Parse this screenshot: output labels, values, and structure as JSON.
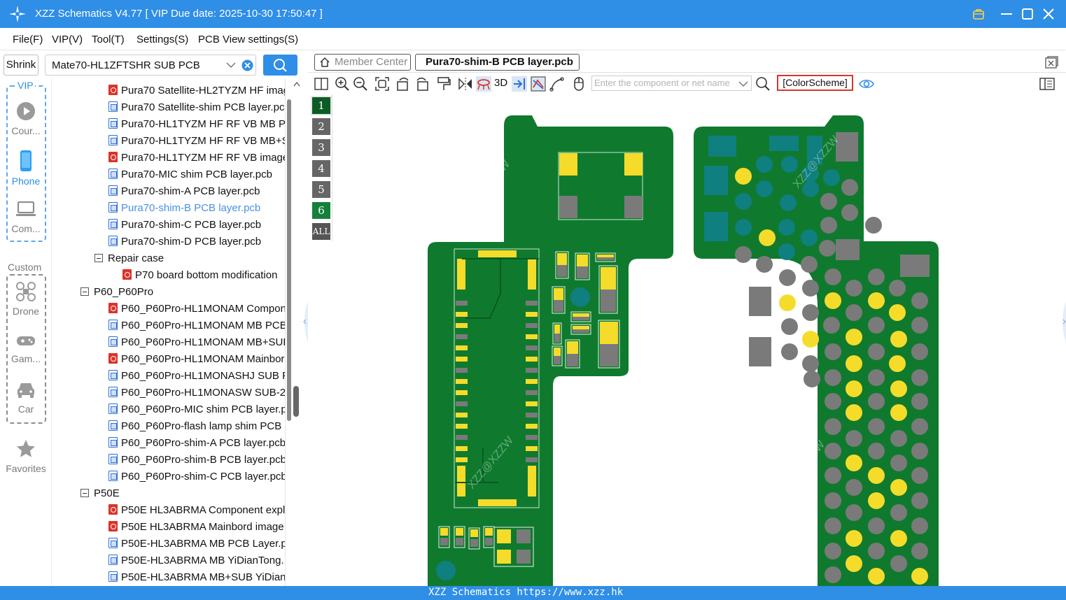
{
  "app": {
    "title": "XZZ Schematics V4.77 [ VIP Due date: 2025-10-30 17:50:47 ]"
  },
  "menu": [
    "File(F)",
    "VIP(V)",
    "Tool(T)",
    "Settings(S)",
    "PCB View settings(S)"
  ],
  "left": {
    "shrink_label": "Shrink",
    "db_value": "Mate70-HL1ZFTSHR SUB PCB",
    "vip_label": "VIP",
    "custom_label": "Custom",
    "vip_items": [
      {
        "label": "Cour...",
        "icon": "play-circle-icon"
      },
      {
        "label": "Phone",
        "icon": "phone-icon",
        "active": true
      },
      {
        "label": "Com...",
        "icon": "laptop-icon"
      }
    ],
    "custom_items": [
      {
        "label": "Drone",
        "icon": "drone-icon"
      },
      {
        "label": "Gam...",
        "icon": "gamepad-icon"
      },
      {
        "label": "Car",
        "icon": "car-icon"
      }
    ],
    "favorites_label": "Favorites"
  },
  "tree": [
    {
      "type": "pdf",
      "label": "Pura70 Satellite-HL2TYZM HF imag",
      "level": 2
    },
    {
      "type": "pcb",
      "label": "Pura70 Satellite-shim PCB layer.pcl",
      "level": 2
    },
    {
      "type": "pcb",
      "label": "Pura70-HL1TYZM HF RF VB MB PC",
      "level": 2
    },
    {
      "type": "pcb",
      "label": "Pura70-HL1TYZM HF RF VB MB+SU",
      "level": 2
    },
    {
      "type": "pdf",
      "label": "Pura70-HL1TYZM HF RF VB image.",
      "level": 2
    },
    {
      "type": "pcb",
      "label": "Pura70-MIC shim PCB layer.pcb",
      "level": 2
    },
    {
      "type": "pcb",
      "label": "Pura70-shim-A PCB layer.pcb",
      "level": 2
    },
    {
      "type": "pcb",
      "label": "Pura70-shim-B PCB layer.pcb",
      "level": 2,
      "selected": true
    },
    {
      "type": "pcb",
      "label": "Pura70-shim-C PCB layer.pcb",
      "level": 2
    },
    {
      "type": "pcb",
      "label": "Pura70-shim-D PCB layer.pcb",
      "level": 2
    },
    {
      "type": "folder",
      "label": "Repair case",
      "level": 2
    },
    {
      "type": "pdf",
      "label": "P70 board bottom modification",
      "level": 3
    },
    {
      "type": "folder",
      "label": "P60_P60Pro",
      "level": 1
    },
    {
      "type": "pdf",
      "label": "P60_P60Pro-HL1MONAM Compon",
      "level": 2
    },
    {
      "type": "pcb",
      "label": "P60_P60Pro-HL1MONAM MB PCB",
      "level": 2
    },
    {
      "type": "pcb",
      "label": "P60_P60Pro-HL1MONAM MB+SUE",
      "level": 2
    },
    {
      "type": "pdf",
      "label": "P60_P60Pro-HL1MONAM Mainbor",
      "level": 2
    },
    {
      "type": "pcb",
      "label": "P60_P60Pro-HL1MONASHJ SUB PC",
      "level": 2
    },
    {
      "type": "pcb",
      "label": "P60_P60Pro-HL1MONASW SUB-2 I",
      "level": 2
    },
    {
      "type": "pcb",
      "label": "P60_P60Pro-MIC shim PCB layer.pc",
      "level": 2
    },
    {
      "type": "pcb",
      "label": "P60_P60Pro-flash lamp shim PCB l",
      "level": 2
    },
    {
      "type": "pcb",
      "label": "P60_P60Pro-shim-A PCB layer.pcb",
      "level": 2
    },
    {
      "type": "pcb",
      "label": "P60_P60Pro-shim-B PCB layer.pcb",
      "level": 2
    },
    {
      "type": "pcb",
      "label": "P60_P60Pro-shim-C PCB layer.pcb",
      "level": 2
    },
    {
      "type": "folder",
      "label": "P50E",
      "level": 1
    },
    {
      "type": "pdf",
      "label": "P50E HL3ABRMA Component expl",
      "level": 2
    },
    {
      "type": "pdf",
      "label": "P50E HL3ABRMA Mainbord image",
      "level": 2
    },
    {
      "type": "pcb",
      "label": "P50E-HL3ABRMA MB PCB Layer.pc",
      "level": 2
    },
    {
      "type": "pcb",
      "label": "P50E-HL3ABRMA MB YiDianTong.",
      "level": 2
    },
    {
      "type": "pcb",
      "label": "P50E-HL3ABRMA MB+SUB YiDian",
      "level": 2
    }
  ],
  "viewer": {
    "tab_member": "Member Center",
    "tab_active": "Pura70-shim-B PCB layer.pcb",
    "btn_3d": "3D",
    "net_placeholder": "Enter the component or net name",
    "color_scheme": "[ColorScheme]",
    "layers": [
      "1",
      "2",
      "3",
      "4",
      "5",
      "6",
      "ALL"
    ],
    "watermark": "XZZ@XZZW"
  },
  "colors": {
    "accent": "#2f8ee6",
    "board": "#0f7a2e",
    "pad_gold": "#f5dc2a",
    "pad_gray": "#7a7a7a",
    "pad_teal": "#0f7f7f"
  },
  "status": "XZZ Schematics https://www.xzz.hk"
}
